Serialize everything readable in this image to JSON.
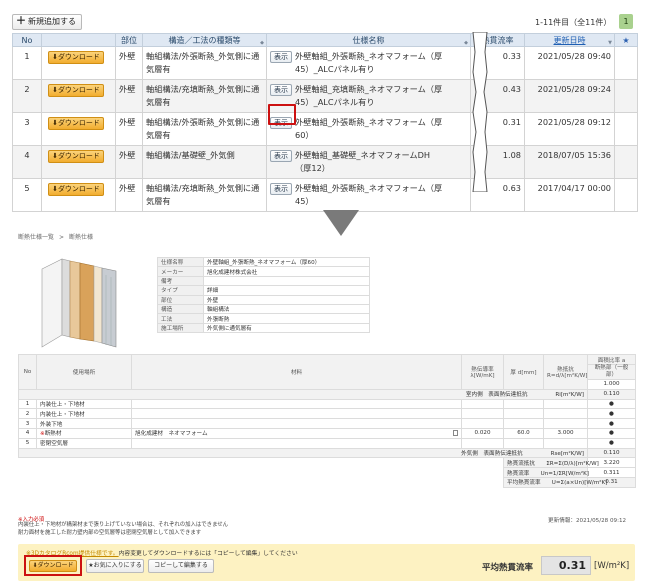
{
  "list": {
    "add_button": "新規追加する",
    "pager": "1-11件目（全11件）",
    "page_current": "1",
    "headers": [
      "No",
      "",
      "部位",
      "構造／工法の種類等",
      "仕様名称",
      "熱貫流率",
      "更新日時",
      "★"
    ],
    "download_label": "ダウンロード",
    "show_label": "表示",
    "rows": [
      {
        "no": "1",
        "part": "外壁",
        "method": "軸組構法/外張断熱_外気側に通気層有",
        "name": "外壁軸組_外張断熱_ネオマフォーム（厚45）_ALCパネル有り",
        "value": "0.33",
        "date": "2021/05/28 09:40"
      },
      {
        "no": "2",
        "part": "外壁",
        "method": "軸組構法/充填断熱_外気側に通気層有",
        "name": "外壁軸組_充填断熱_ネオマフォーム（厚45）_ALCパネル有り",
        "value": "0.43",
        "date": "2021/05/28 09:24"
      },
      {
        "no": "3",
        "part": "外壁",
        "method": "軸組構法/外張断熱_外気側に通気層有",
        "name": "外壁軸組_外張断熱_ネオマフォーム（厚60）",
        "value": "0.31",
        "date": "2021/05/28 09:12"
      },
      {
        "no": "4",
        "part": "外壁",
        "method": "軸組構法/基礎壁_外気側",
        "name": "外壁軸組_基礎壁_ネオマフォームDH（厚12）",
        "value": "1.08",
        "date": "2018/07/05 15:36"
      },
      {
        "no": "5",
        "part": "外壁",
        "method": "軸組構法/充填断熱_外気側に通気層有",
        "name": "外壁軸組_外張断熱_ネオマフォーム（厚45）",
        "value": "0.63",
        "date": "2017/04/17 00:00"
      }
    ]
  },
  "detail": {
    "breadcrumb": [
      "断熱仕様一覧",
      "断熱仕様"
    ],
    "info": [
      {
        "k": "仕様名称",
        "v": "外壁軸組_外張断熱_ネオマフォーム（厚60）"
      },
      {
        "k": "メーカー",
        "v": "旭化成建材株式会社"
      },
      {
        "k": "備考",
        "v": ""
      },
      {
        "k": "タイプ",
        "v": "詳細"
      },
      {
        "k": "部位",
        "v": "外壁"
      },
      {
        "k": "構造",
        "v": "軸組構法"
      },
      {
        "k": "工法",
        "v": "外張断熱"
      },
      {
        "k": "施工場所",
        "v": "外気側に通気層有"
      }
    ],
    "spec_headers": {
      "no": "No",
      "place": "使用場所",
      "material": "材料",
      "conductivity": "熱伝導率",
      "conductivity_unit": "λ[W/mK]",
      "thickness": "厚 d[mm]",
      "resistance": "熱抵抗",
      "resistance_unit": "R=d/λ[m²K/W]",
      "ratio": "面積比率 a",
      "ratio_sub": "断熱部（一般部）",
      "ratio_value": "1.000"
    },
    "surface_outer": {
      "label": "室内側　表面熱伝達抵抗",
      "unit": "Ri[m²K/W]",
      "value": "0.110"
    },
    "layers": [
      {
        "no": "1",
        "mark": "",
        "place": "内装仕上・下地材",
        "material": "",
        "lambda": "",
        "d": "",
        "r": "",
        "dot": "●"
      },
      {
        "no": "2",
        "mark": "",
        "place": "内装仕上・下地材",
        "material": "",
        "lambda": "",
        "d": "",
        "r": "",
        "dot": "●"
      },
      {
        "no": "3",
        "mark": "",
        "place": "外装下地",
        "material": "",
        "lambda": "",
        "d": "",
        "r": "",
        "dot": "●"
      },
      {
        "no": "4",
        "mark": "※",
        "place": "断熱材",
        "material": "旭化成建材　ネオマフォーム",
        "lambda": "0.020",
        "d": "60.0",
        "r": "3.000",
        "dot": "●"
      },
      {
        "no": "5",
        "mark": "",
        "place": "密閉空気層",
        "material": "",
        "lambda": "",
        "d": "",
        "r": "",
        "dot": "●"
      }
    ],
    "surface_inner": {
      "label": "外気側　表面熱伝達抵抗",
      "unit": "Rse[m²K/W]",
      "value": "0.110"
    },
    "totals": [
      {
        "label": "熱貫流抵抗",
        "formula": "ΣR=Σ(D/λ)[m²K/W]",
        "value": "3.220"
      },
      {
        "label": "熱貫流率",
        "formula": "Un=1/ΣR[W/m²K]",
        "value": "0.311"
      },
      {
        "label": "平均熱貫流率",
        "formula": "U=Σ(a×Un)[W/m²K]",
        "value": "0.31"
      }
    ],
    "required_note": "※入力必須",
    "notes": [
      "内装仕上・下地材が構架材まで張り上げていない場合は、それぞれの加入はできません",
      "耐力面材を施工した耐力壁内部の空気層等は密閉空気層として加入できます"
    ],
    "updated": "更新情報：2021/05/28 09:12"
  },
  "footer": {
    "notice_link": "※3DカタログRcom提供仕様です。",
    "notice_text": "内容変更してダウンロードするには「コピーして編集」してください",
    "download": "ダウンロード",
    "favorite": "★お気に入りにする",
    "copy_edit": "コピーして編集する",
    "avg_label": "平均熱貫流率",
    "avg_value": "0.31",
    "avg_unit": "[W/m²K]"
  },
  "colors": {
    "highlight": "#cc1111",
    "download": "#f2ad2f",
    "header_bg": "#dfe8f3",
    "notice_bg": "#fdf2c2",
    "page_badge": "#a9d18e"
  }
}
